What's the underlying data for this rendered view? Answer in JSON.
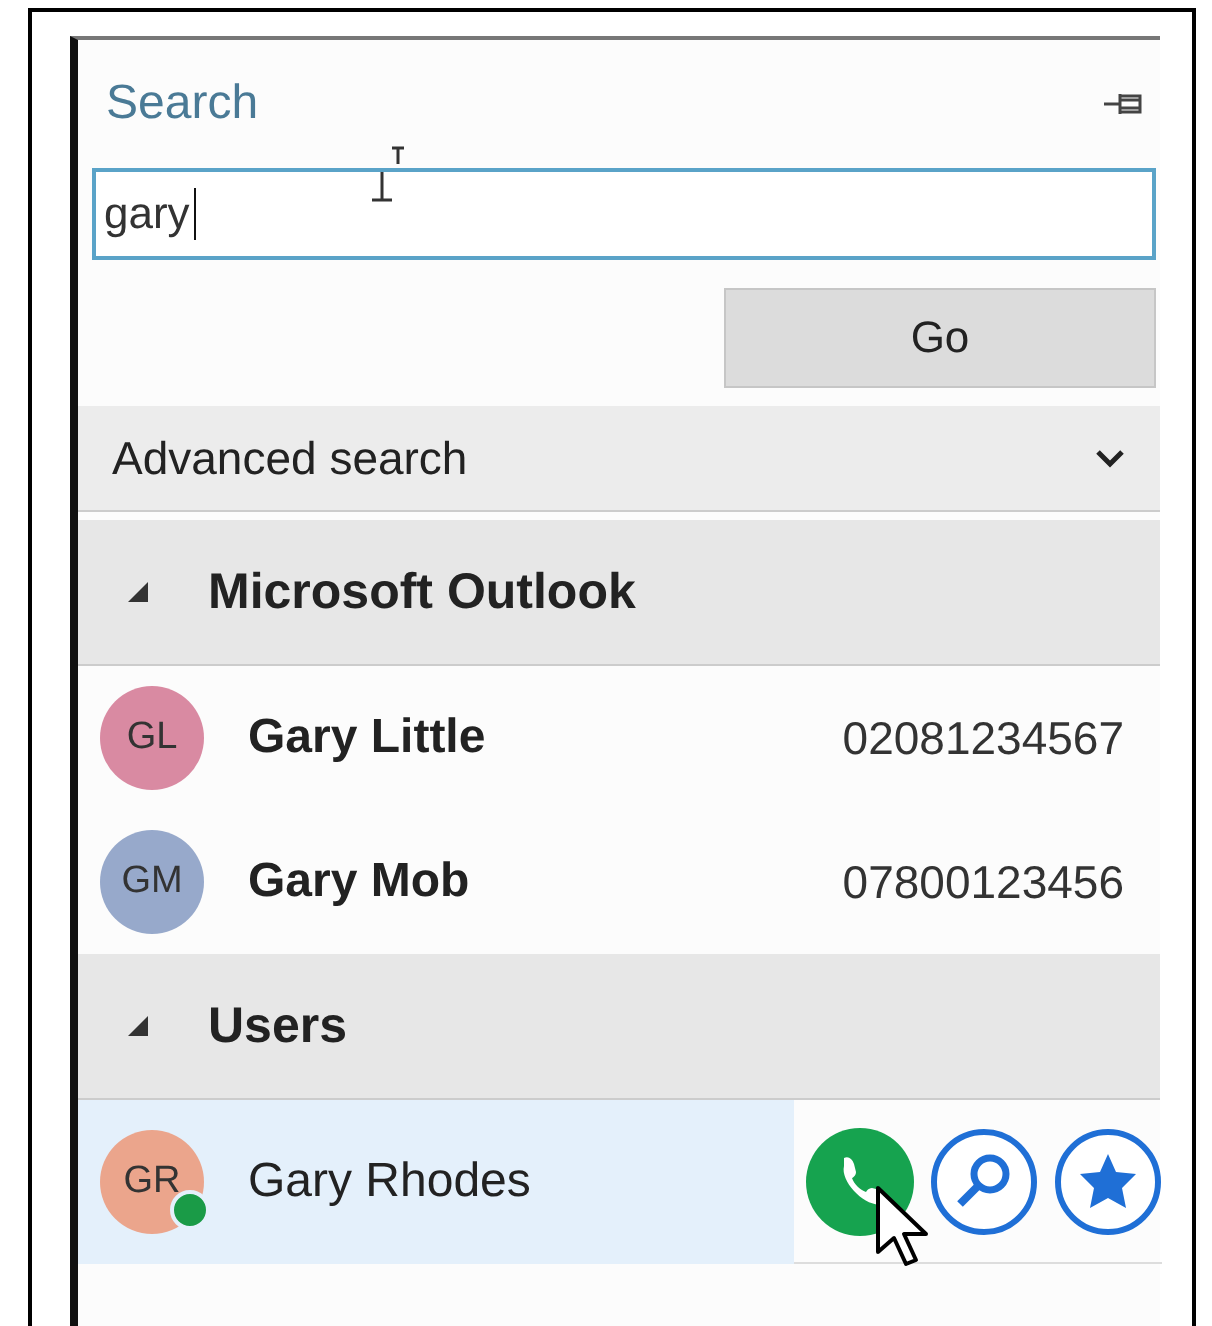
{
  "panel": {
    "title": "Search"
  },
  "search": {
    "value": "gary"
  },
  "go_button": "Go",
  "advanced": {
    "label": "Advanced search",
    "expanded": false
  },
  "groups": [
    {
      "name": "Microsoft Outlook",
      "kind": "external",
      "expanded": true,
      "contacts": [
        {
          "initials": "GL",
          "name": "Gary Little",
          "number": "02081234567",
          "color": "#d98aa2",
          "online": false,
          "selected": false
        },
        {
          "initials": "GM",
          "name": "Gary Mob",
          "number": "07800123456",
          "color": "#97a9cb",
          "online": false,
          "selected": false
        }
      ]
    },
    {
      "name": "Users",
      "kind": "user",
      "expanded": true,
      "contacts": [
        {
          "initials": "GR",
          "name": "Gary Rhodes",
          "color": "#eba58c",
          "online": true,
          "selected": true
        }
      ]
    }
  ]
}
